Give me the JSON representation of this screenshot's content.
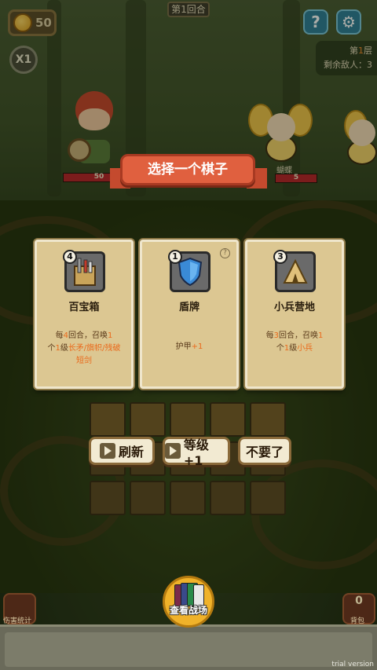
{
  "hud": {
    "coins": "50",
    "speed": "X1",
    "round": "第1回合",
    "floor": "第1层",
    "floor_label_prefix": "第",
    "floor_number": "1",
    "floor_label_suffix": "层",
    "enemies_left": "剩余敌人：3",
    "help_icon": "question-icon",
    "settings_icon": "gear-icon"
  },
  "battlefield": {
    "hero_hp": "50",
    "bee_name": "蝴蝶",
    "bee_hp": "5"
  },
  "dialog": {
    "title": "选择一个棋子",
    "cards": [
      {
        "level": "4",
        "icon": "treasure-box-icon",
        "name": "百宝箱",
        "desc_parts": [
          "每",
          "4",
          "回合，召唤",
          "1",
          "个",
          "1",
          "级",
          "长矛/旗帜/残破短剑"
        ]
      },
      {
        "level": "1",
        "icon": "shield-icon",
        "name": "盾牌",
        "desc_parts": [
          "护甲",
          "+1"
        ],
        "help": "?"
      },
      {
        "level": "3",
        "icon": "tent-icon",
        "name": "小兵营地",
        "desc_parts": [
          "每",
          "3",
          "回合，召唤",
          "1",
          "个",
          "1",
          "级",
          "小兵"
        ]
      }
    ],
    "buttons": {
      "refresh": "刷新",
      "level_up": "等级+1",
      "skip": "不要了"
    }
  },
  "bottom": {
    "view_battlefield": "查看战场",
    "left_label": "伤害统计",
    "right_label": "背包",
    "right_count": "0"
  },
  "watermark": "trial version",
  "colors": {
    "accent_orange": "#ea6a1c",
    "ribbon": "#e0603f",
    "card_bg": "#dcc792",
    "hp_red": "#b8242a"
  }
}
